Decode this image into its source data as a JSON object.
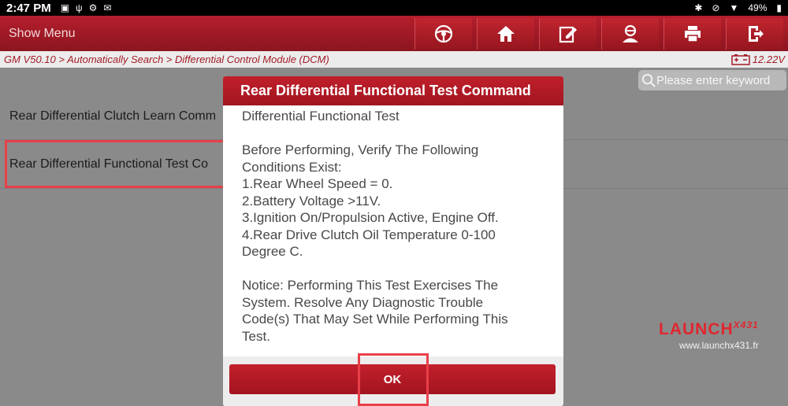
{
  "status_bar": {
    "time": "2:47 PM",
    "battery": "49%"
  },
  "app_bar": {
    "menu_label": "Show Menu",
    "toolbar_icons": [
      "steering-wheel-icon",
      "home-icon",
      "edit-icon",
      "user-icon",
      "printer-icon",
      "exit-icon"
    ]
  },
  "breadcrumb": {
    "path": "GM V50.10 > Automatically Search > Differential Control Module (DCM)",
    "voltage": "12.22V"
  },
  "search": {
    "placeholder": "Please enter keyword"
  },
  "list": {
    "items": [
      {
        "label": "Rear Differential Clutch Learn Comm"
      },
      {
        "label": "Rear Differential Functional Test Co"
      }
    ]
  },
  "dialog": {
    "title": "Rear Differential Functional Test Command",
    "lines": [
      "Differential Functional Test",
      "",
      "Before Performing, Verify The Following",
      "Conditions Exist:",
      "1.Rear Wheel Speed = 0.",
      "2.Battery Voltage >11V.",
      "3.Ignition On/Propulsion Active, Engine Off.",
      "4.Rear Drive Clutch Oil Temperature 0-100",
      "Degree C.",
      "",
      "Notice: Performing This Test Exercises The",
      "System. Resolve Any Diagnostic Trouble",
      "Code(s) That May Set While Performing This",
      "Test."
    ],
    "ok_label": "OK"
  },
  "watermark": {
    "brand": "LAUNCH",
    "model": "X431",
    "url": "www.launchx431.fr"
  },
  "colors": {
    "brand_red": "#a81b26",
    "highlight_red": "#e8404a"
  }
}
